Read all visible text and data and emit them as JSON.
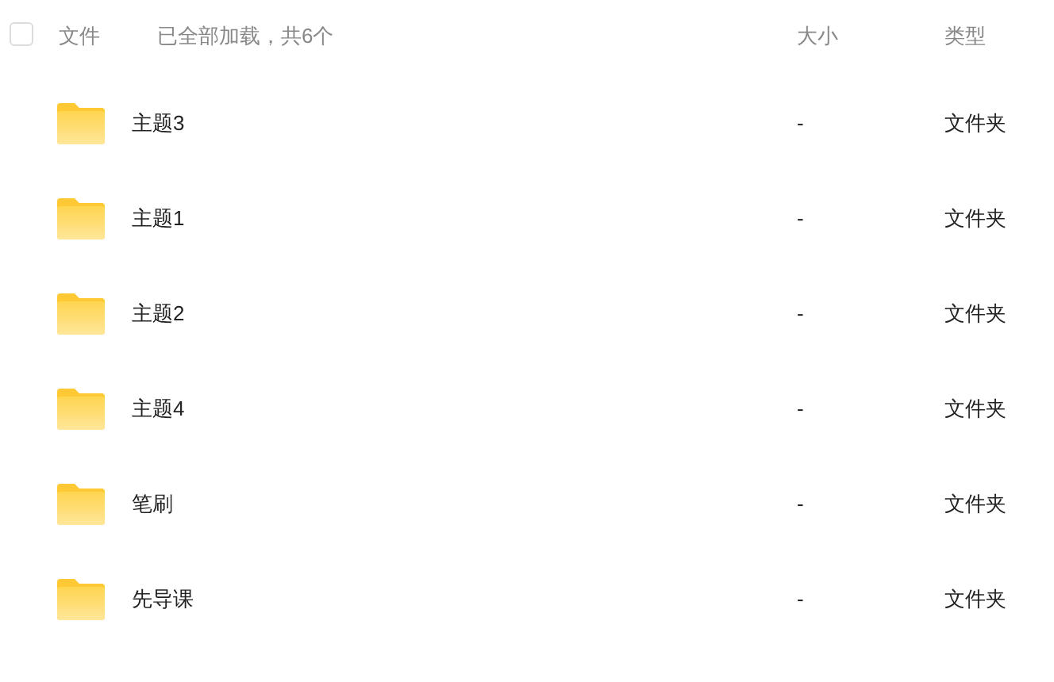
{
  "header": {
    "select_all": {
      "checked": false
    },
    "name_column": "文件",
    "load_status": "已全部加载，共6个",
    "size_column": "大小",
    "type_column": "类型"
  },
  "files": [
    {
      "name": "主题3",
      "size": "-",
      "type": "文件夹"
    },
    {
      "name": "主题1",
      "size": "-",
      "type": "文件夹"
    },
    {
      "name": "主题2",
      "size": "-",
      "type": "文件夹"
    },
    {
      "name": "主题4",
      "size": "-",
      "type": "文件夹"
    },
    {
      "name": "笔刷",
      "size": "-",
      "type": "文件夹"
    },
    {
      "name": "先导课",
      "size": "-",
      "type": "文件夹"
    }
  ]
}
